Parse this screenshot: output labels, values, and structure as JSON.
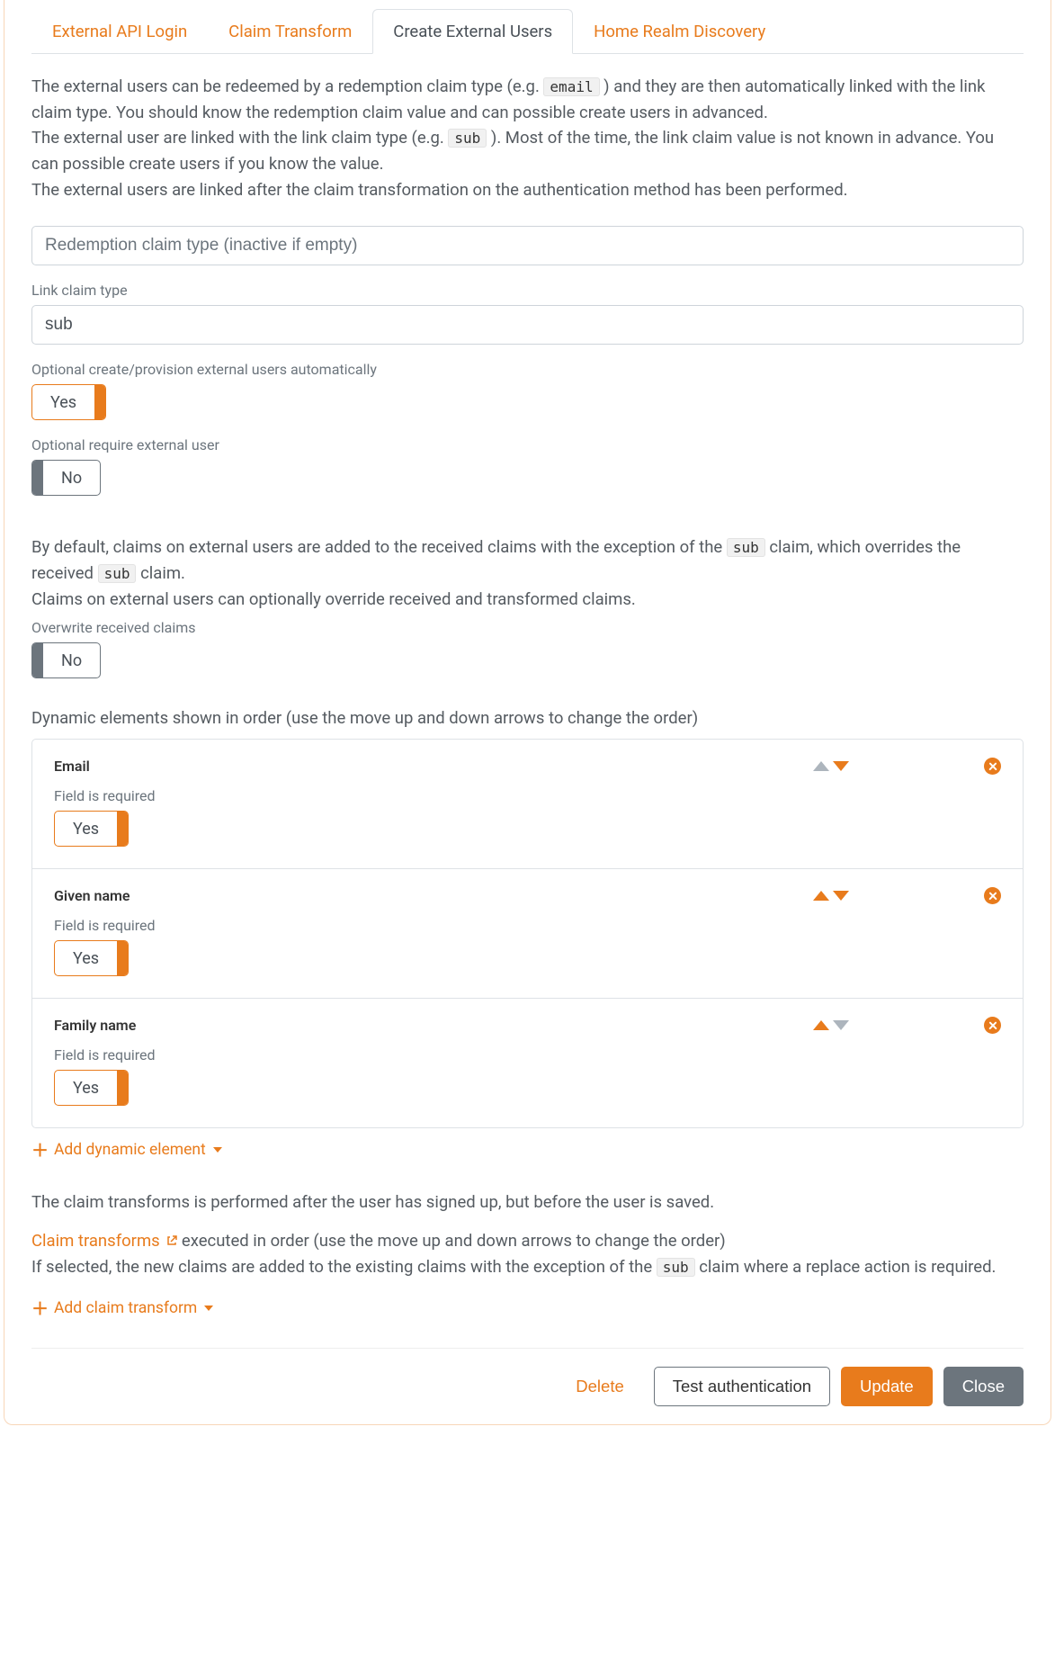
{
  "tabs": {
    "t1": "External API Login",
    "t2": "Claim Transform",
    "t3": "Create External Users",
    "t4": "Home Realm Discovery"
  },
  "intro": {
    "p1a": "The external users can be redeemed by a redemption claim type (e.g. ",
    "p1code": "email",
    "p1b": " ) and they are then automatically linked with the link claim type. You should know the redemption claim value and can possible create users in advanced.",
    "p2a": "The external user are linked with the link claim type (e.g. ",
    "p2code": "sub",
    "p2b": " ). Most of the time, the link claim value is not known in advance. You can possible create users if you know the value.",
    "p3": "The external users are linked after the claim transformation on the authentication method has been performed."
  },
  "fields": {
    "redemption_placeholder": "Redemption claim type (inactive if empty)",
    "link_label": "Link claim type",
    "link_value": "sub",
    "auto_label": "Optional create/provision external users automatically",
    "auto_value": "Yes",
    "require_label": "Optional require external user",
    "require_value": "No"
  },
  "mid": {
    "p1a": "By default, claims on external users are added to the received claims with the exception of the ",
    "p1code": "sub",
    "p1b": " claim, which overrides the received ",
    "p1code2": "sub",
    "p1c": " claim.",
    "p2": "Claims on external users can optionally override received and transformed claims.",
    "over_label": "Overwrite received claims",
    "over_value": "No"
  },
  "dynamic": {
    "header": "Dynamic elements shown in order (use the move up and down arrows to change the order)",
    "required_label": "Field is required",
    "items": [
      {
        "name": "Email",
        "req": "Yes",
        "up": false,
        "down": true
      },
      {
        "name": "Given name",
        "req": "Yes",
        "up": true,
        "down": true
      },
      {
        "name": "Family name",
        "req": "Yes",
        "up": true,
        "down": false
      }
    ],
    "add": "Add dynamic element"
  },
  "claims": {
    "p1": "The claim transforms is performed after the user has signed up, but before the user is saved.",
    "link": "Claim transforms",
    "p2": " executed in order (use the move up and down arrows to change the order)",
    "p3a": "If selected, the new claims are added to the existing claims with the exception of the ",
    "p3code": "sub",
    "p3b": " claim where a replace action is required.",
    "add": "Add claim transform"
  },
  "footer": {
    "delete": "Delete",
    "test": "Test authentication",
    "update": "Update",
    "close": "Close"
  }
}
